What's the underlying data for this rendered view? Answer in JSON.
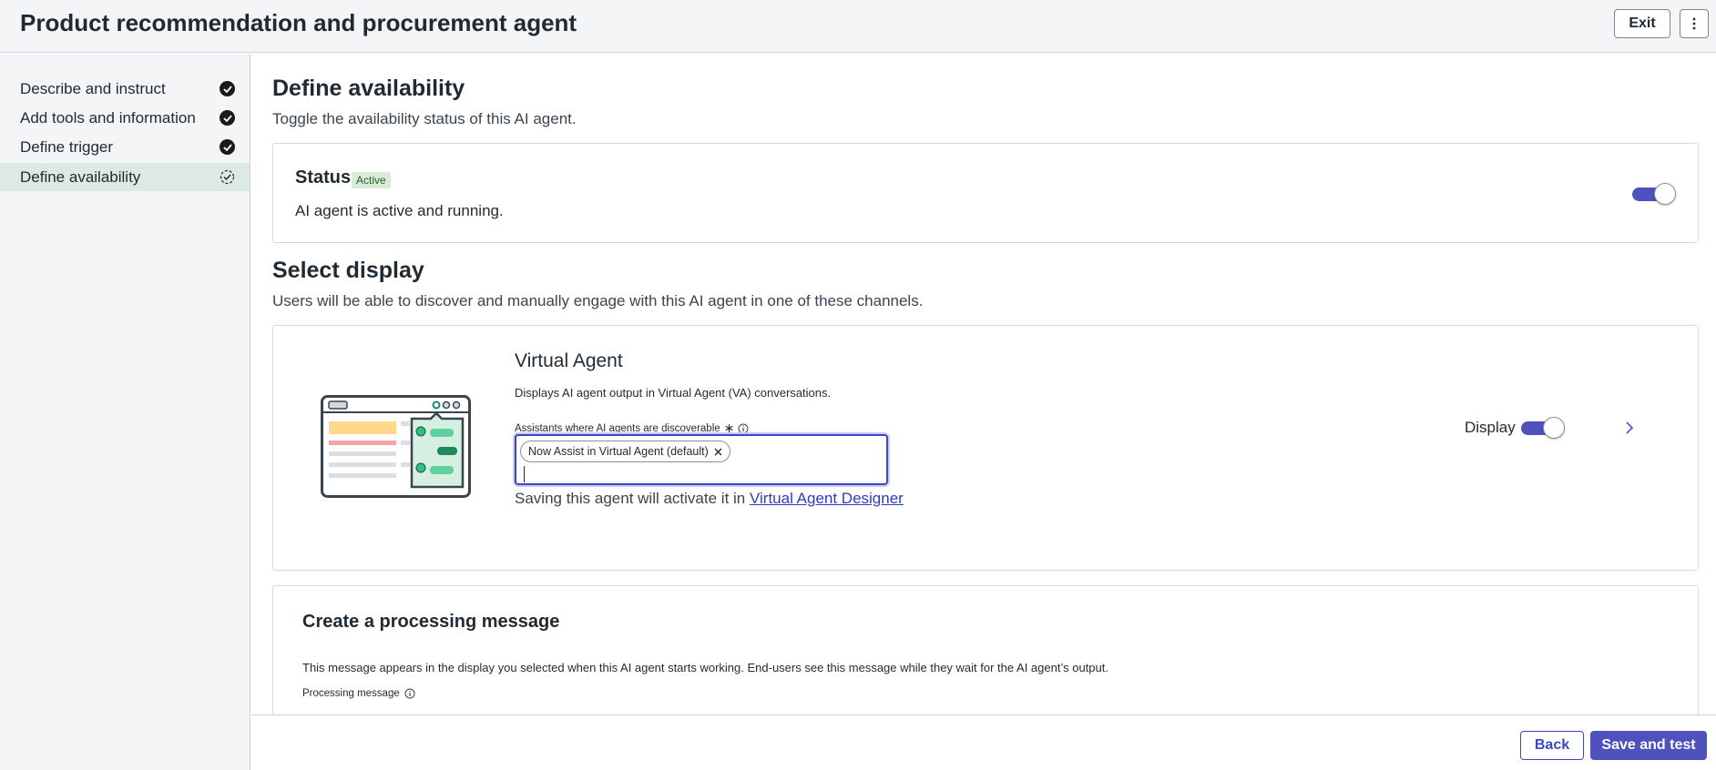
{
  "header": {
    "title": "Product recommendation and procurement agent",
    "exit_label": "Exit",
    "more_icon": "more-vertical-icon"
  },
  "sidebar": {
    "items": [
      {
        "label": "Describe and instruct",
        "status": "complete"
      },
      {
        "label": "Add tools and information",
        "status": "complete"
      },
      {
        "label": "Define trigger",
        "status": "complete"
      },
      {
        "label": "Define availability",
        "status": "in-progress",
        "active": true
      }
    ]
  },
  "availability": {
    "title": "Define availability",
    "subtitle": "Toggle the availability status of this AI agent.",
    "status": {
      "label": "Status",
      "badge": "Active",
      "description": "AI agent is active and running.",
      "toggle_on": true
    }
  },
  "display": {
    "title": "Select display",
    "subtitle": "Users will be able to discover and manually engage with this AI agent in one of these channels.",
    "virtual_agent": {
      "title": "Virtual Agent",
      "description": "Displays AI agent output in Virtual Agent (VA) conversations.",
      "field_label": "Assistants where AI agents are discoverable",
      "required_mark": "∗",
      "chip": "Now Assist in Virtual Agent (default)",
      "save_note": "Saving this agent will activate it in",
      "link_text": "Virtual Agent Designer",
      "display_label": "Display",
      "display_toggle_on": true
    }
  },
  "processing": {
    "title": "Create a processing message",
    "description": "This message appears in the display you selected when this AI agent starts working. End-users see this message while they wait for the AI agent’s output.",
    "field_label": "Processing message"
  },
  "footer": {
    "back_label": "Back",
    "save_label": "Save and test"
  },
  "colors": {
    "accent": "#4f52bd",
    "active_step_bg": "#dde9e4",
    "badge_bg": "#d9ecd8"
  }
}
